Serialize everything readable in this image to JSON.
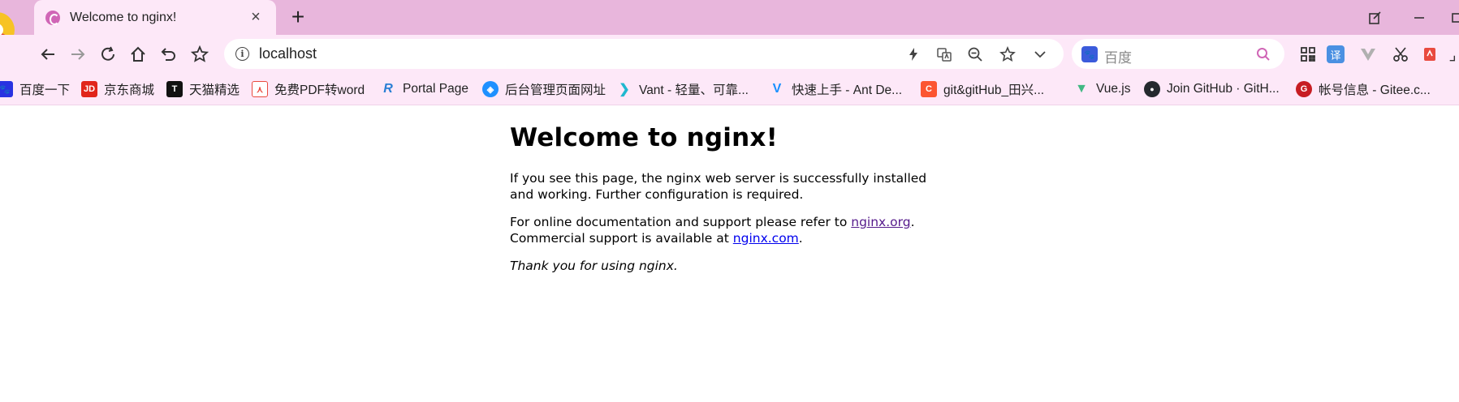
{
  "tab": {
    "title": "Welcome to nginx!",
    "close_glyph": "×"
  },
  "new_tab_glyph": "+",
  "toolbar": {
    "url": "localhost",
    "info_glyph": "i",
    "search_placeholder": "百度"
  },
  "bookmarks": [
    {
      "label": "百度一下",
      "icon": "baidu-icon",
      "icon_text": "🐾",
      "color": "#2932e1"
    },
    {
      "label": "京东商城",
      "icon": "jd-icon",
      "icon_text": "JD",
      "color": "#e1251b"
    },
    {
      "label": "天猫精选",
      "icon": "tmall-icon",
      "icon_text": "T",
      "color": "#111111"
    },
    {
      "label": "免费PDF转word",
      "icon": "pdf-icon",
      "icon_text": "⋏",
      "color": "#e94a3f"
    },
    {
      "label": "Portal Page",
      "icon": "portal-icon",
      "icon_text": "R",
      "color": "#2a7fd4"
    },
    {
      "label": "后台管理页面网址",
      "icon": "admin-icon",
      "icon_text": "◈",
      "color": "#1e90ff"
    },
    {
      "label": "Vant - 轻量、可靠...",
      "icon": "vant-icon",
      "icon_text": "❯",
      "color": "#1fb8cf"
    },
    {
      "label": "快速上手 - Ant De...",
      "icon": "ant-design-icon",
      "icon_text": "V",
      "color": "#1890ff"
    },
    {
      "label": "git&gitHub_田兴...",
      "icon": "csdn-icon",
      "icon_text": "C",
      "color": "#fc5531"
    },
    {
      "label": "Vue.js",
      "icon": "vue-icon",
      "icon_text": "▼",
      "color": "#41b883"
    },
    {
      "label": "Join GitHub · GitH...",
      "icon": "github-icon",
      "icon_text": "●",
      "color": "#24292e"
    },
    {
      "label": "帐号信息 - Gitee.c...",
      "icon": "gitee-icon",
      "icon_text": "G",
      "color": "#c71d23"
    }
  ],
  "page": {
    "heading": "Welcome to nginx!",
    "para1": "If you see this page, the nginx web server is successfully installed and working. Further configuration is required.",
    "para2_prefix": "For online documentation and support please refer to ",
    "link1": "nginx.org",
    "para2_mid": ".",
    "para2_line2_prefix": "Commercial support is available at ",
    "link2": "nginx.com",
    "para2_suffix": ".",
    "thanks": "Thank you for using nginx."
  },
  "colors": {
    "tabstrip": "#e8b6dc",
    "toolbar": "#fde8f8",
    "accent": "#d066b6",
    "link": "#0000ee",
    "visited_link": "#551a8b"
  }
}
